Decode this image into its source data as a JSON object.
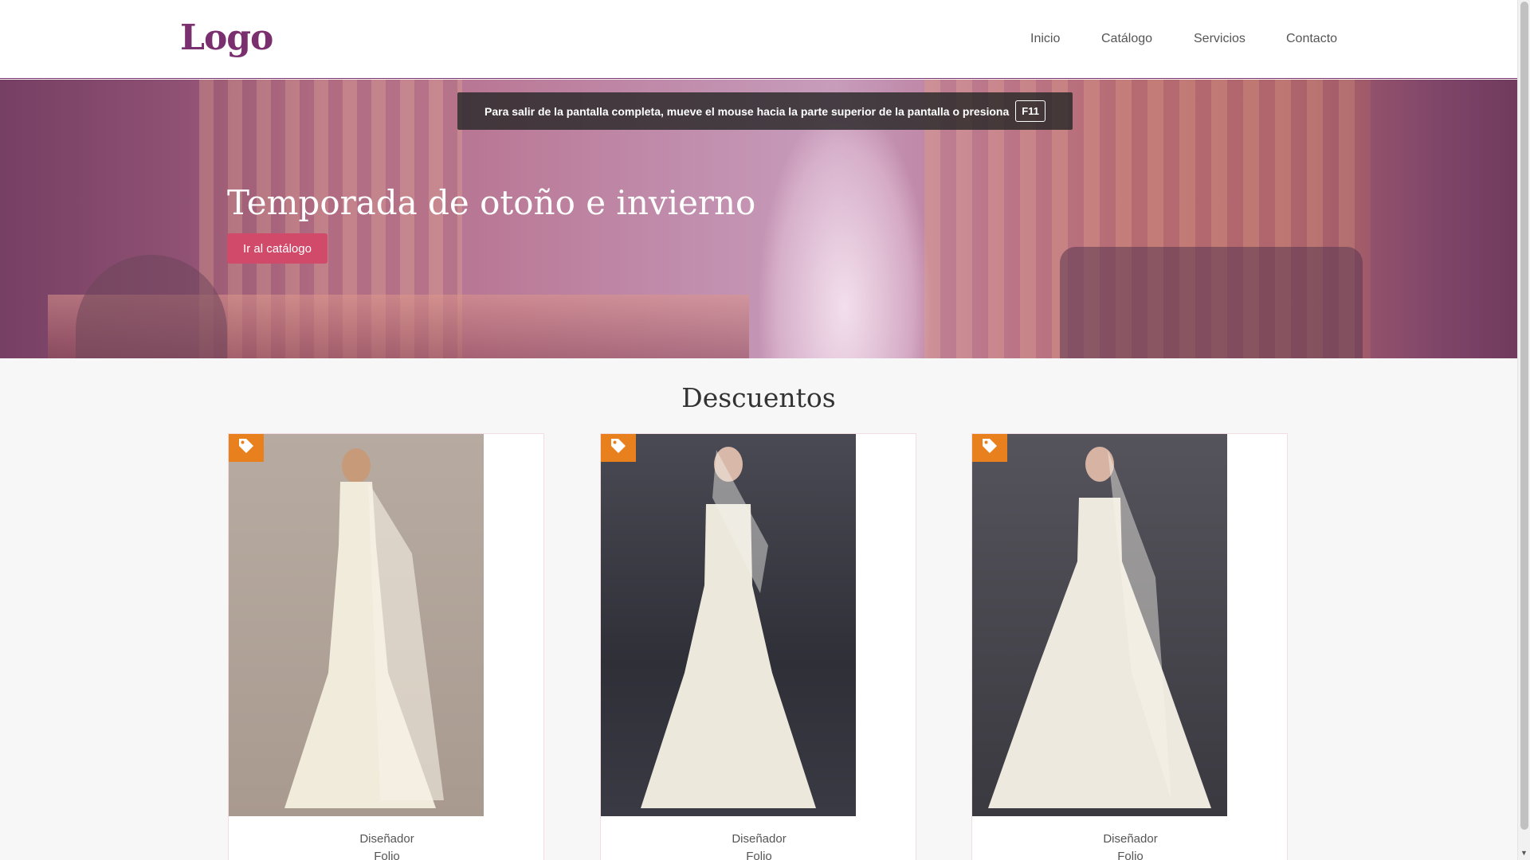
{
  "header": {
    "logo": "Logo",
    "nav": [
      {
        "label": "Inicio"
      },
      {
        "label": "Catálogo"
      },
      {
        "label": "Servicios"
      },
      {
        "label": "Contacto"
      }
    ]
  },
  "fullscreen_notice": {
    "text": "Para salir de la pantalla completa, mueve el mouse hacia la parte superior de la pantalla o presiona",
    "key": "F11"
  },
  "hero": {
    "title": "Temporada de otoño e invierno",
    "button_label": "Ir al catálogo"
  },
  "discounts": {
    "title": "Descuentos",
    "cards": [
      {
        "designer": "Diseñador",
        "folio": "Folio",
        "tag_icon": "tag-icon"
      },
      {
        "designer": "Diseñador",
        "folio": "Folio",
        "tag_icon": "tag-icon"
      },
      {
        "designer": "Diseñador",
        "folio": "Folio",
        "tag_icon": "tag-icon"
      }
    ]
  },
  "colors": {
    "brand": "#7a2f6e",
    "accent_button": "#d14a6a",
    "tag": "#e8801e"
  }
}
